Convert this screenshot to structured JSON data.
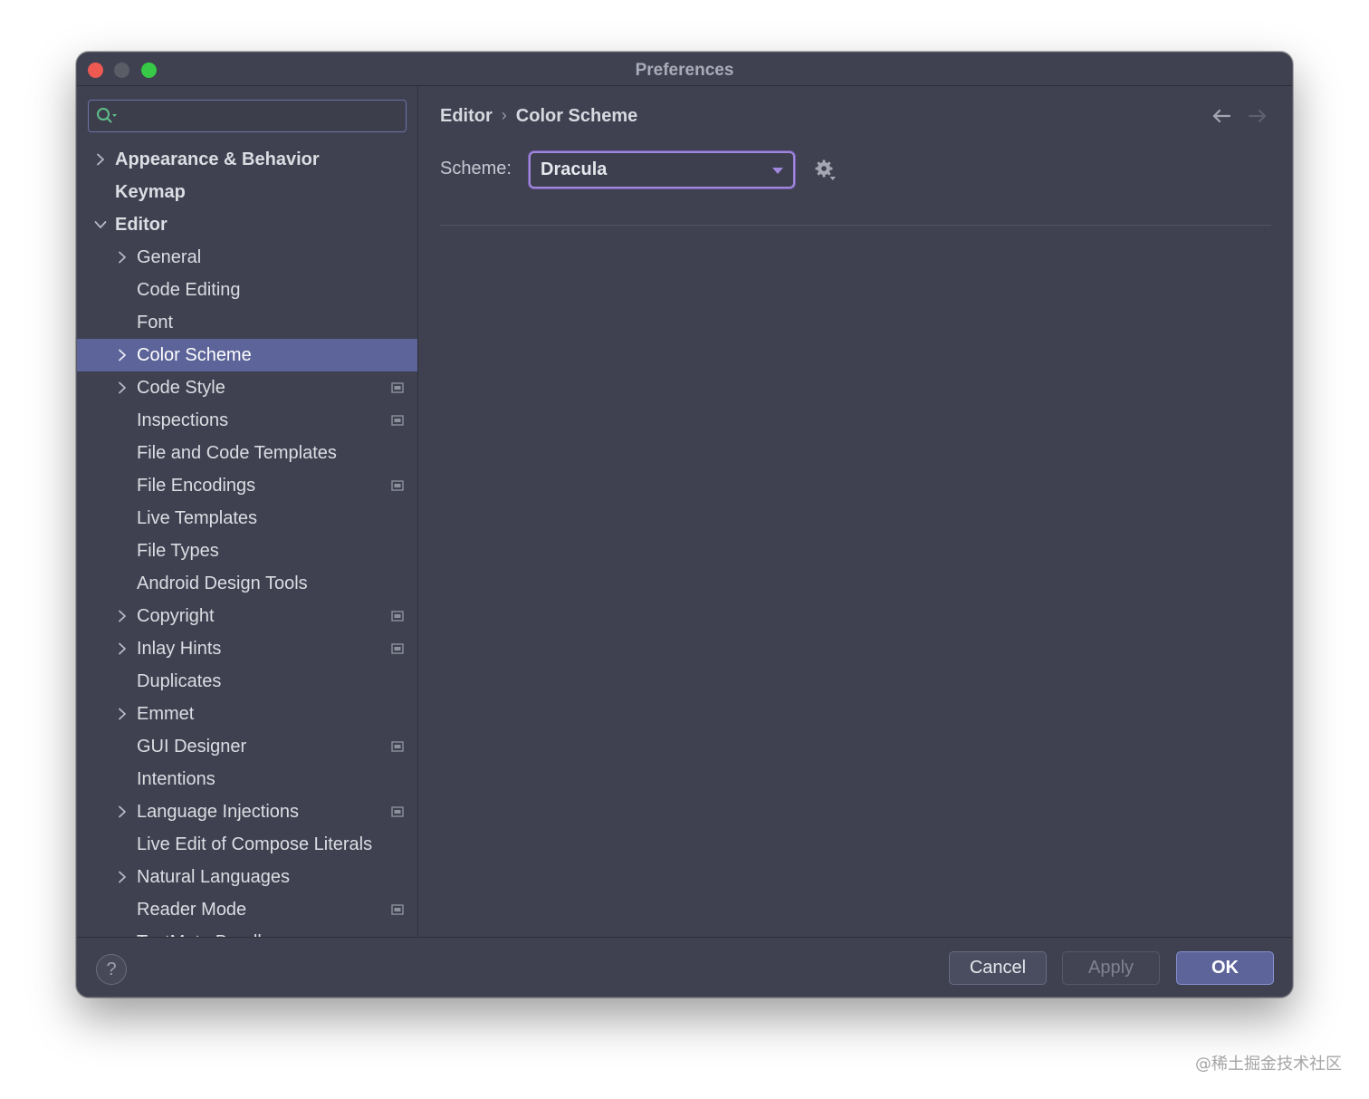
{
  "window": {
    "title": "Preferences"
  },
  "search": {
    "value": "",
    "placeholder": ""
  },
  "tree": [
    {
      "label": "Appearance & Behavior",
      "bold": true,
      "chevron": "right",
      "indent": 0
    },
    {
      "label": "Keymap",
      "bold": true,
      "chevron": "",
      "indent": 0
    },
    {
      "label": "Editor",
      "bold": true,
      "chevron": "down",
      "indent": 0
    },
    {
      "label": "General",
      "chevron": "right",
      "indent": 1
    },
    {
      "label": "Code Editing",
      "chevron": "",
      "indent": 1
    },
    {
      "label": "Font",
      "chevron": "",
      "indent": 1
    },
    {
      "label": "Color Scheme",
      "chevron": "right",
      "indent": 1,
      "selected": true
    },
    {
      "label": "Code Style",
      "chevron": "right",
      "indent": 1,
      "project": true
    },
    {
      "label": "Inspections",
      "chevron": "",
      "indent": 1,
      "project": true
    },
    {
      "label": "File and Code Templates",
      "chevron": "",
      "indent": 1
    },
    {
      "label": "File Encodings",
      "chevron": "",
      "indent": 1,
      "project": true
    },
    {
      "label": "Live Templates",
      "chevron": "",
      "indent": 1
    },
    {
      "label": "File Types",
      "chevron": "",
      "indent": 1
    },
    {
      "label": "Android Design Tools",
      "chevron": "",
      "indent": 1
    },
    {
      "label": "Copyright",
      "chevron": "right",
      "indent": 1,
      "project": true
    },
    {
      "label": "Inlay Hints",
      "chevron": "right",
      "indent": 1,
      "project": true
    },
    {
      "label": "Duplicates",
      "chevron": "",
      "indent": 1
    },
    {
      "label": "Emmet",
      "chevron": "right",
      "indent": 1
    },
    {
      "label": "GUI Designer",
      "chevron": "",
      "indent": 1,
      "project": true
    },
    {
      "label": "Intentions",
      "chevron": "",
      "indent": 1
    },
    {
      "label": "Language Injections",
      "chevron": "right",
      "indent": 1,
      "project": true
    },
    {
      "label": "Live Edit of Compose Literals",
      "chevron": "",
      "indent": 1
    },
    {
      "label": "Natural Languages",
      "chevron": "right",
      "indent": 1
    },
    {
      "label": "Reader Mode",
      "chevron": "",
      "indent": 1,
      "project": true
    },
    {
      "label": "TextMate Bundles",
      "chevron": "",
      "indent": 1
    }
  ],
  "breadcrumb": {
    "parent": "Editor",
    "separator": "›",
    "current": "Color Scheme"
  },
  "scheme": {
    "label": "Scheme:",
    "value": "Dracula"
  },
  "footer": {
    "help": "?",
    "cancel": "Cancel",
    "apply": "Apply",
    "ok": "OK"
  },
  "watermark": "@稀土掘金技术社区",
  "colors": {
    "accent": "#5c6499",
    "focus": "#a187dc",
    "background": "#3f4150"
  }
}
